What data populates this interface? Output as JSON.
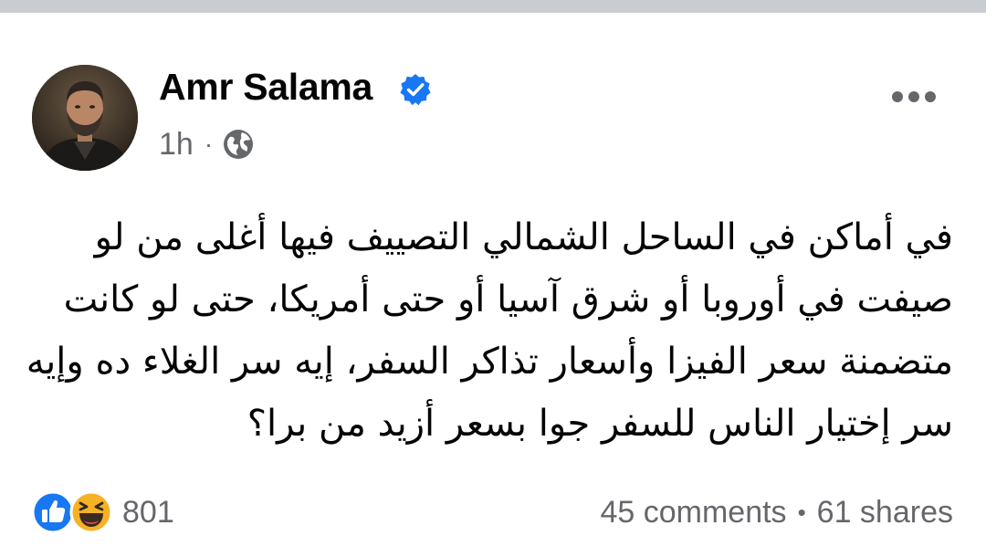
{
  "post": {
    "author": {
      "name": "Amr Salama",
      "verified": true,
      "avatar_icon": "profile-photo"
    },
    "meta": {
      "time": "1h",
      "separator": "·",
      "audience_icon": "globe-icon"
    },
    "text_lines": [
      "في أماكن في الساحل الشمالي التصييف فيها أغلى من لو",
      "صيفت في أوروبا أو شرق آسيا أو حتى أمريكا، حتى لو كانت",
      "متضمنة سعر الفيزا وأسعار تذاكر السفر، إيه سر الغلاء ده وإيه",
      "سر إختيار الناس للسفر جوا بسعر أزيد من برا؟"
    ],
    "reactions": {
      "icons": [
        "like-icon",
        "haha-icon"
      ],
      "count": "801"
    },
    "stats": {
      "comments": "45 comments",
      "separator": "•",
      "shares": "61 shares"
    }
  },
  "colors": {
    "accent": "#1877f2",
    "secondary_text": "#65676b",
    "primary_text": "#050505",
    "haha_yellow": "#f7b125"
  }
}
